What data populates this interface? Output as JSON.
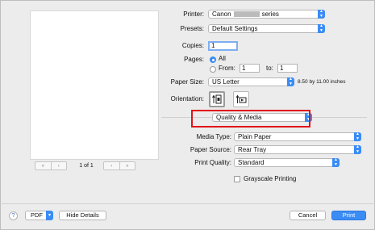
{
  "preview": {
    "page_info": "1 of 1",
    "first_glyph": "«",
    "prev_glyph": "‹",
    "next_glyph": "›",
    "last_glyph": "»"
  },
  "printer": {
    "label": "Printer:",
    "value_prefix": "Canon",
    "value_suffix": "series"
  },
  "presets": {
    "label": "Presets:",
    "value": "Default Settings"
  },
  "copies": {
    "label": "Copies:",
    "value": "1"
  },
  "pages": {
    "label": "Pages:",
    "all_label": "All",
    "from_label": "From:",
    "from_value": "1",
    "to_label": "to:",
    "to_value": "1"
  },
  "paper_size": {
    "label": "Paper Size:",
    "value": "US Letter",
    "dimensions": "8.50 by 11.00 inches"
  },
  "orientation": {
    "label": "Orientation:",
    "portrait_glyph": "↑",
    "landscape_glyph": "↑"
  },
  "section_menu": {
    "value": "Quality & Media"
  },
  "media_type": {
    "label": "Media Type:",
    "value": "Plain Paper"
  },
  "paper_source": {
    "label": "Paper Source:",
    "value": "Rear Tray"
  },
  "print_quality": {
    "label": "Print Quality:",
    "value": "Standard"
  },
  "grayscale": {
    "label": "Grayscale Printing",
    "checked": false
  },
  "footer": {
    "help_glyph": "?",
    "pdf_label": "PDF",
    "hide_details_label": "Hide Details",
    "cancel_label": "Cancel",
    "print_label": "Print"
  },
  "colors": {
    "accent": "#3b8cf5",
    "highlight": "#e0131a"
  }
}
